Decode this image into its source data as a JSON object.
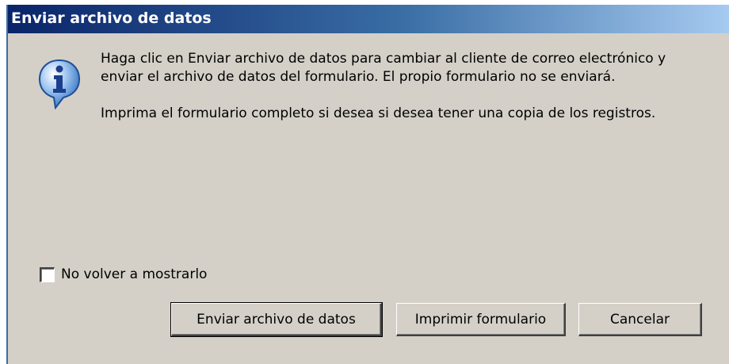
{
  "dialog": {
    "title": "Enviar archivo de datos",
    "icon": "info-icon",
    "message": [
      "Haga clic en Enviar archivo de datos para cambiar al cliente de correo electrónico y enviar el archivo de datos del formulario.  El propio formulario no se enviará.",
      "Imprima el formulario completo si desea si desea tener una copia de los registros."
    ],
    "checkbox": {
      "label": "No volver a mostrarlo",
      "checked": false
    },
    "buttons": {
      "send": "Enviar archivo de datos",
      "print": "Imprimir formulario",
      "cancel": "Cancelar"
    },
    "colors": {
      "title_bar_start": "#0a246a",
      "title_bar_end": "#a6caf0",
      "dialog_face": "#d4d0c8"
    }
  }
}
